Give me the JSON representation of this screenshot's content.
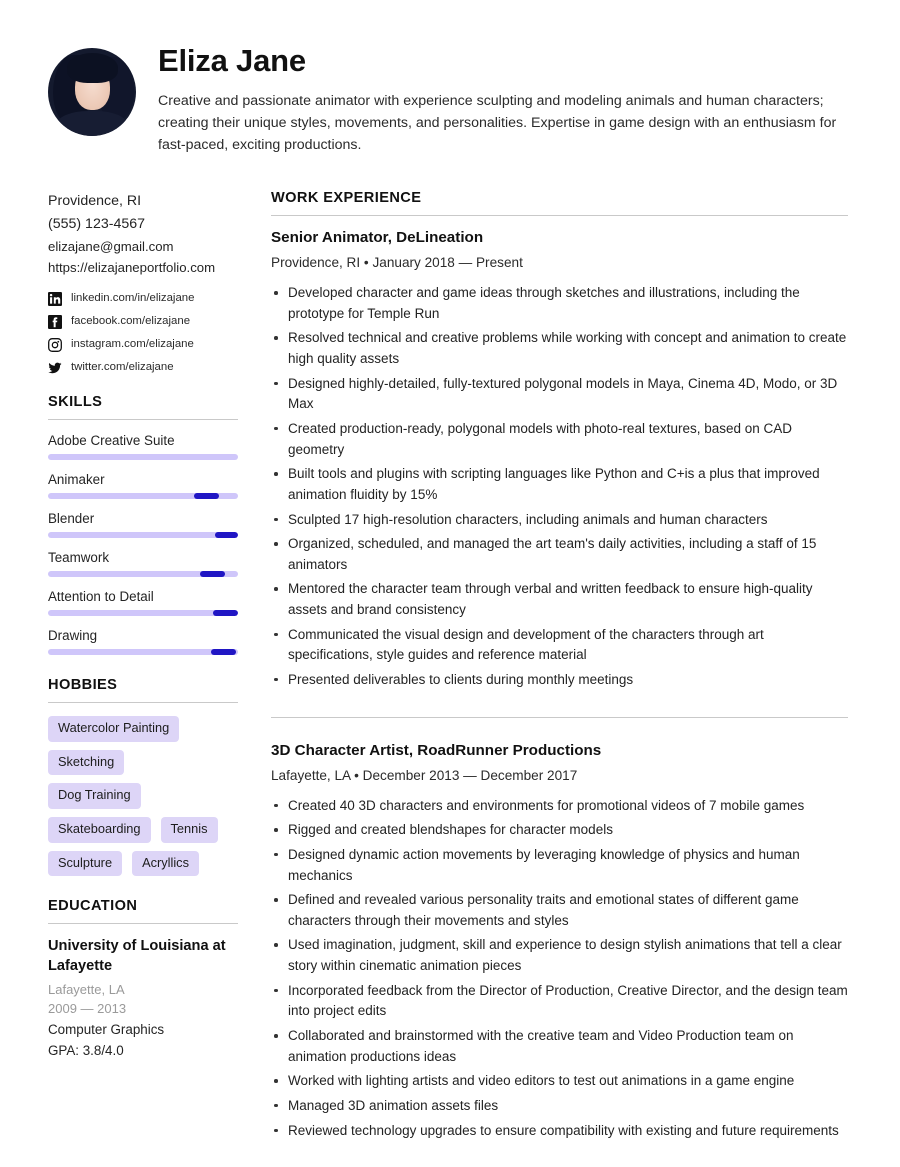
{
  "header": {
    "name": "Eliza Jane",
    "avatar_alt": "profile-photo",
    "summary": "Creative and passionate animator with experience sculpting and modeling animals and human characters; creating their unique styles, movements, and personalities. Expertise in game design with an enthusiasm for fast-paced, exciting productions."
  },
  "contact": {
    "location": "Providence, RI",
    "phone": "(555) 123-4567",
    "email": "elizajane@gmail.com",
    "website": "https://elizajaneportfolio.com",
    "socials": [
      {
        "icon": "linkedin-icon",
        "label": "linkedin.com/in/elizajane"
      },
      {
        "icon": "facebook-icon",
        "label": "facebook.com/elizajane"
      },
      {
        "icon": "instagram-icon",
        "label": "instagram.com/elizajane"
      },
      {
        "icon": "twitter-icon",
        "label": "twitter.com/elizajane"
      }
    ]
  },
  "skills": {
    "heading": "SKILLS",
    "items": [
      {
        "name": "Adobe Creative Suite",
        "level": 100
      },
      {
        "name": "Animaker",
        "level": 77
      },
      {
        "name": "Blender",
        "level": 88
      },
      {
        "name": "Teamwork",
        "level": 80
      },
      {
        "name": "Attention to Detail",
        "level": 87
      },
      {
        "name": "Drawing",
        "level": 86
      }
    ]
  },
  "hobbies": {
    "heading": "HOBBIES",
    "rows": [
      [
        "Watercolor Painting"
      ],
      [
        "Sketching"
      ],
      [
        "Dog Training"
      ],
      [
        "Skateboarding",
        "Tennis"
      ],
      [
        "Sculpture",
        "Acryllics"
      ]
    ]
  },
  "education": {
    "heading": "EDUCATION",
    "school": "University of Louisiana at Lafayette",
    "location": "Lafayette, LA",
    "dates": "2009 — 2013",
    "field": "Computer Graphics",
    "gpa": "GPA: 3.8/4.0"
  },
  "experience": {
    "heading": "WORK EXPERIENCE",
    "jobs": [
      {
        "title": "Senior Animator, DeLineation",
        "meta": "Providence, RI • January 2018 — Present",
        "bullets": [
          "Developed character and game ideas through sketches and illustrations, including the prototype for Temple Run",
          "Resolved technical and creative problems while working with concept and animation to create high quality assets",
          "Designed highly-detailed, fully-textured polygonal models in Maya, Cinema 4D, Modo, or 3D Max",
          "Created production-ready, polygonal models with photo-real textures, based on CAD geometry",
          "Built tools and plugins with scripting languages like Python and C+is a plus that improved animation fluidity by 15%",
          "Sculpted 17 high-resolution characters, including animals and human characters",
          "Organized, scheduled, and managed the art team's daily activities, including a staff of 15 animators",
          "Mentored the character team through verbal and written feedback to ensure high-quality assets and brand consistency",
          "Communicated the visual design and development of the characters through art specifications, style guides and reference material",
          "Presented deliverables to clients during monthly meetings"
        ]
      },
      {
        "title": "3D Character Artist, RoadRunner Productions",
        "meta": "Lafayette, LA • December 2013 — December 2017",
        "bullets": [
          "Created 40 3D characters and environments for promotional videos of 7 mobile games",
          "Rigged and created blendshapes for character models",
          "Designed dynamic action movements by leveraging knowledge of physics and human mechanics",
          "Defined and revealed various personality traits and emotional states of different game characters through their movements and styles",
          "Used imagination, judgment, skill and experience to design stylish animations that tell a clear story within cinematic animation pieces",
          "Incorporated feedback from the Director of Production, Creative Director, and the design team into project edits",
          "Collaborated and brainstormed with the creative team and Video Production team on animation productions ideas",
          "Worked with lighting artists and video editors to test out animations in a game engine",
          "Managed 3D animation assets files",
          "Reviewed technology upgrades to ensure compatibility with existing and future requirements"
        ]
      }
    ]
  },
  "colors": {
    "accent_dark": "#2016c4",
    "accent_light": "#cfc6fa",
    "tag_bg": "#ddd5f7",
    "rule": "#c9c9c9"
  }
}
